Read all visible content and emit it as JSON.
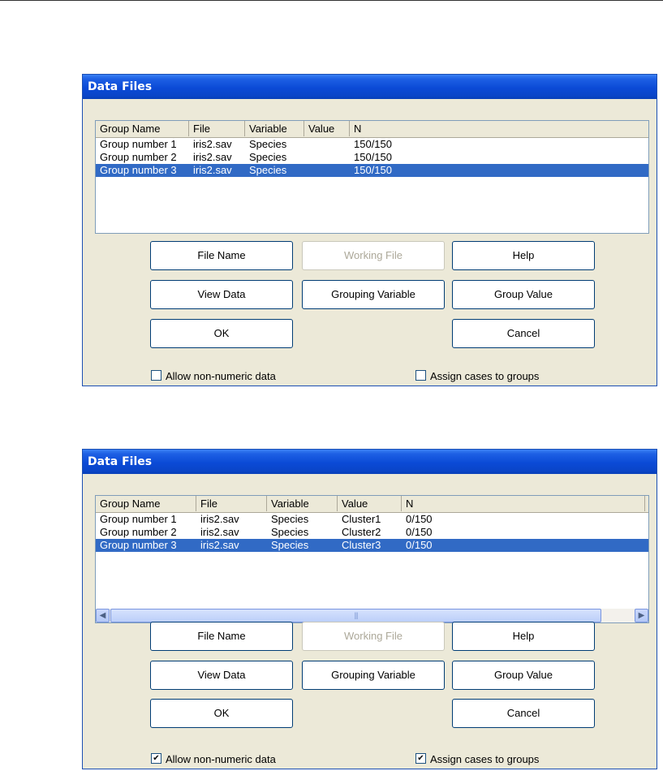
{
  "dialogs": [
    {
      "title": "Data Files",
      "columns": [
        "Group Name",
        "File",
        "Variable",
        "Value",
        "N"
      ],
      "rows": [
        [
          "Group number 1",
          "iris2.sav",
          "Species",
          "",
          "150/150"
        ],
        [
          "Group number 2",
          "iris2.sav",
          "Species",
          "",
          "150/150"
        ],
        [
          "Group number 3",
          "iris2.sav",
          "Species",
          "",
          "150/150"
        ]
      ],
      "selected_row": 3,
      "has_hscroll": false,
      "buttons": {
        "file_name": "File Name",
        "working_file": "Working File",
        "help": "Help",
        "view_data": "View Data",
        "grouping_variable": "Grouping Variable",
        "group_value": "Group Value",
        "ok": "OK",
        "cancel": "Cancel"
      },
      "working_file_enabled": false,
      "checkboxes": {
        "allow_non_numeric": {
          "label": "Allow non-numeric data",
          "checked": false
        },
        "assign_cases": {
          "label": "Assign cases to groups",
          "checked": false
        }
      }
    },
    {
      "title": "Data Files",
      "columns": [
        "Group Name",
        "File",
        "Variable",
        "Value",
        "N"
      ],
      "rows": [
        [
          "Group number 1",
          "iris2.sav",
          "Species",
          "Cluster1",
          "0/150"
        ],
        [
          "Group number 2",
          "iris2.sav",
          "Species",
          "Cluster2",
          "0/150"
        ],
        [
          "Group number 3",
          "iris2.sav",
          "Species",
          "Cluster3",
          "0/150"
        ]
      ],
      "selected_row": 3,
      "has_hscroll": true,
      "buttons": {
        "file_name": "File Name",
        "working_file": "Working File",
        "help": "Help",
        "view_data": "View Data",
        "grouping_variable": "Grouping Variable",
        "group_value": "Group Value",
        "ok": "OK",
        "cancel": "Cancel"
      },
      "working_file_enabled": false,
      "checkboxes": {
        "allow_non_numeric": {
          "label": "Allow non-numeric data",
          "checked": true
        },
        "assign_cases": {
          "label": "Assign cases to groups",
          "checked": true
        }
      }
    }
  ],
  "colors": {
    "title_bar": "#0a45c9",
    "dialog_bg": "#ece9d8",
    "selection": "#316ac5"
  }
}
